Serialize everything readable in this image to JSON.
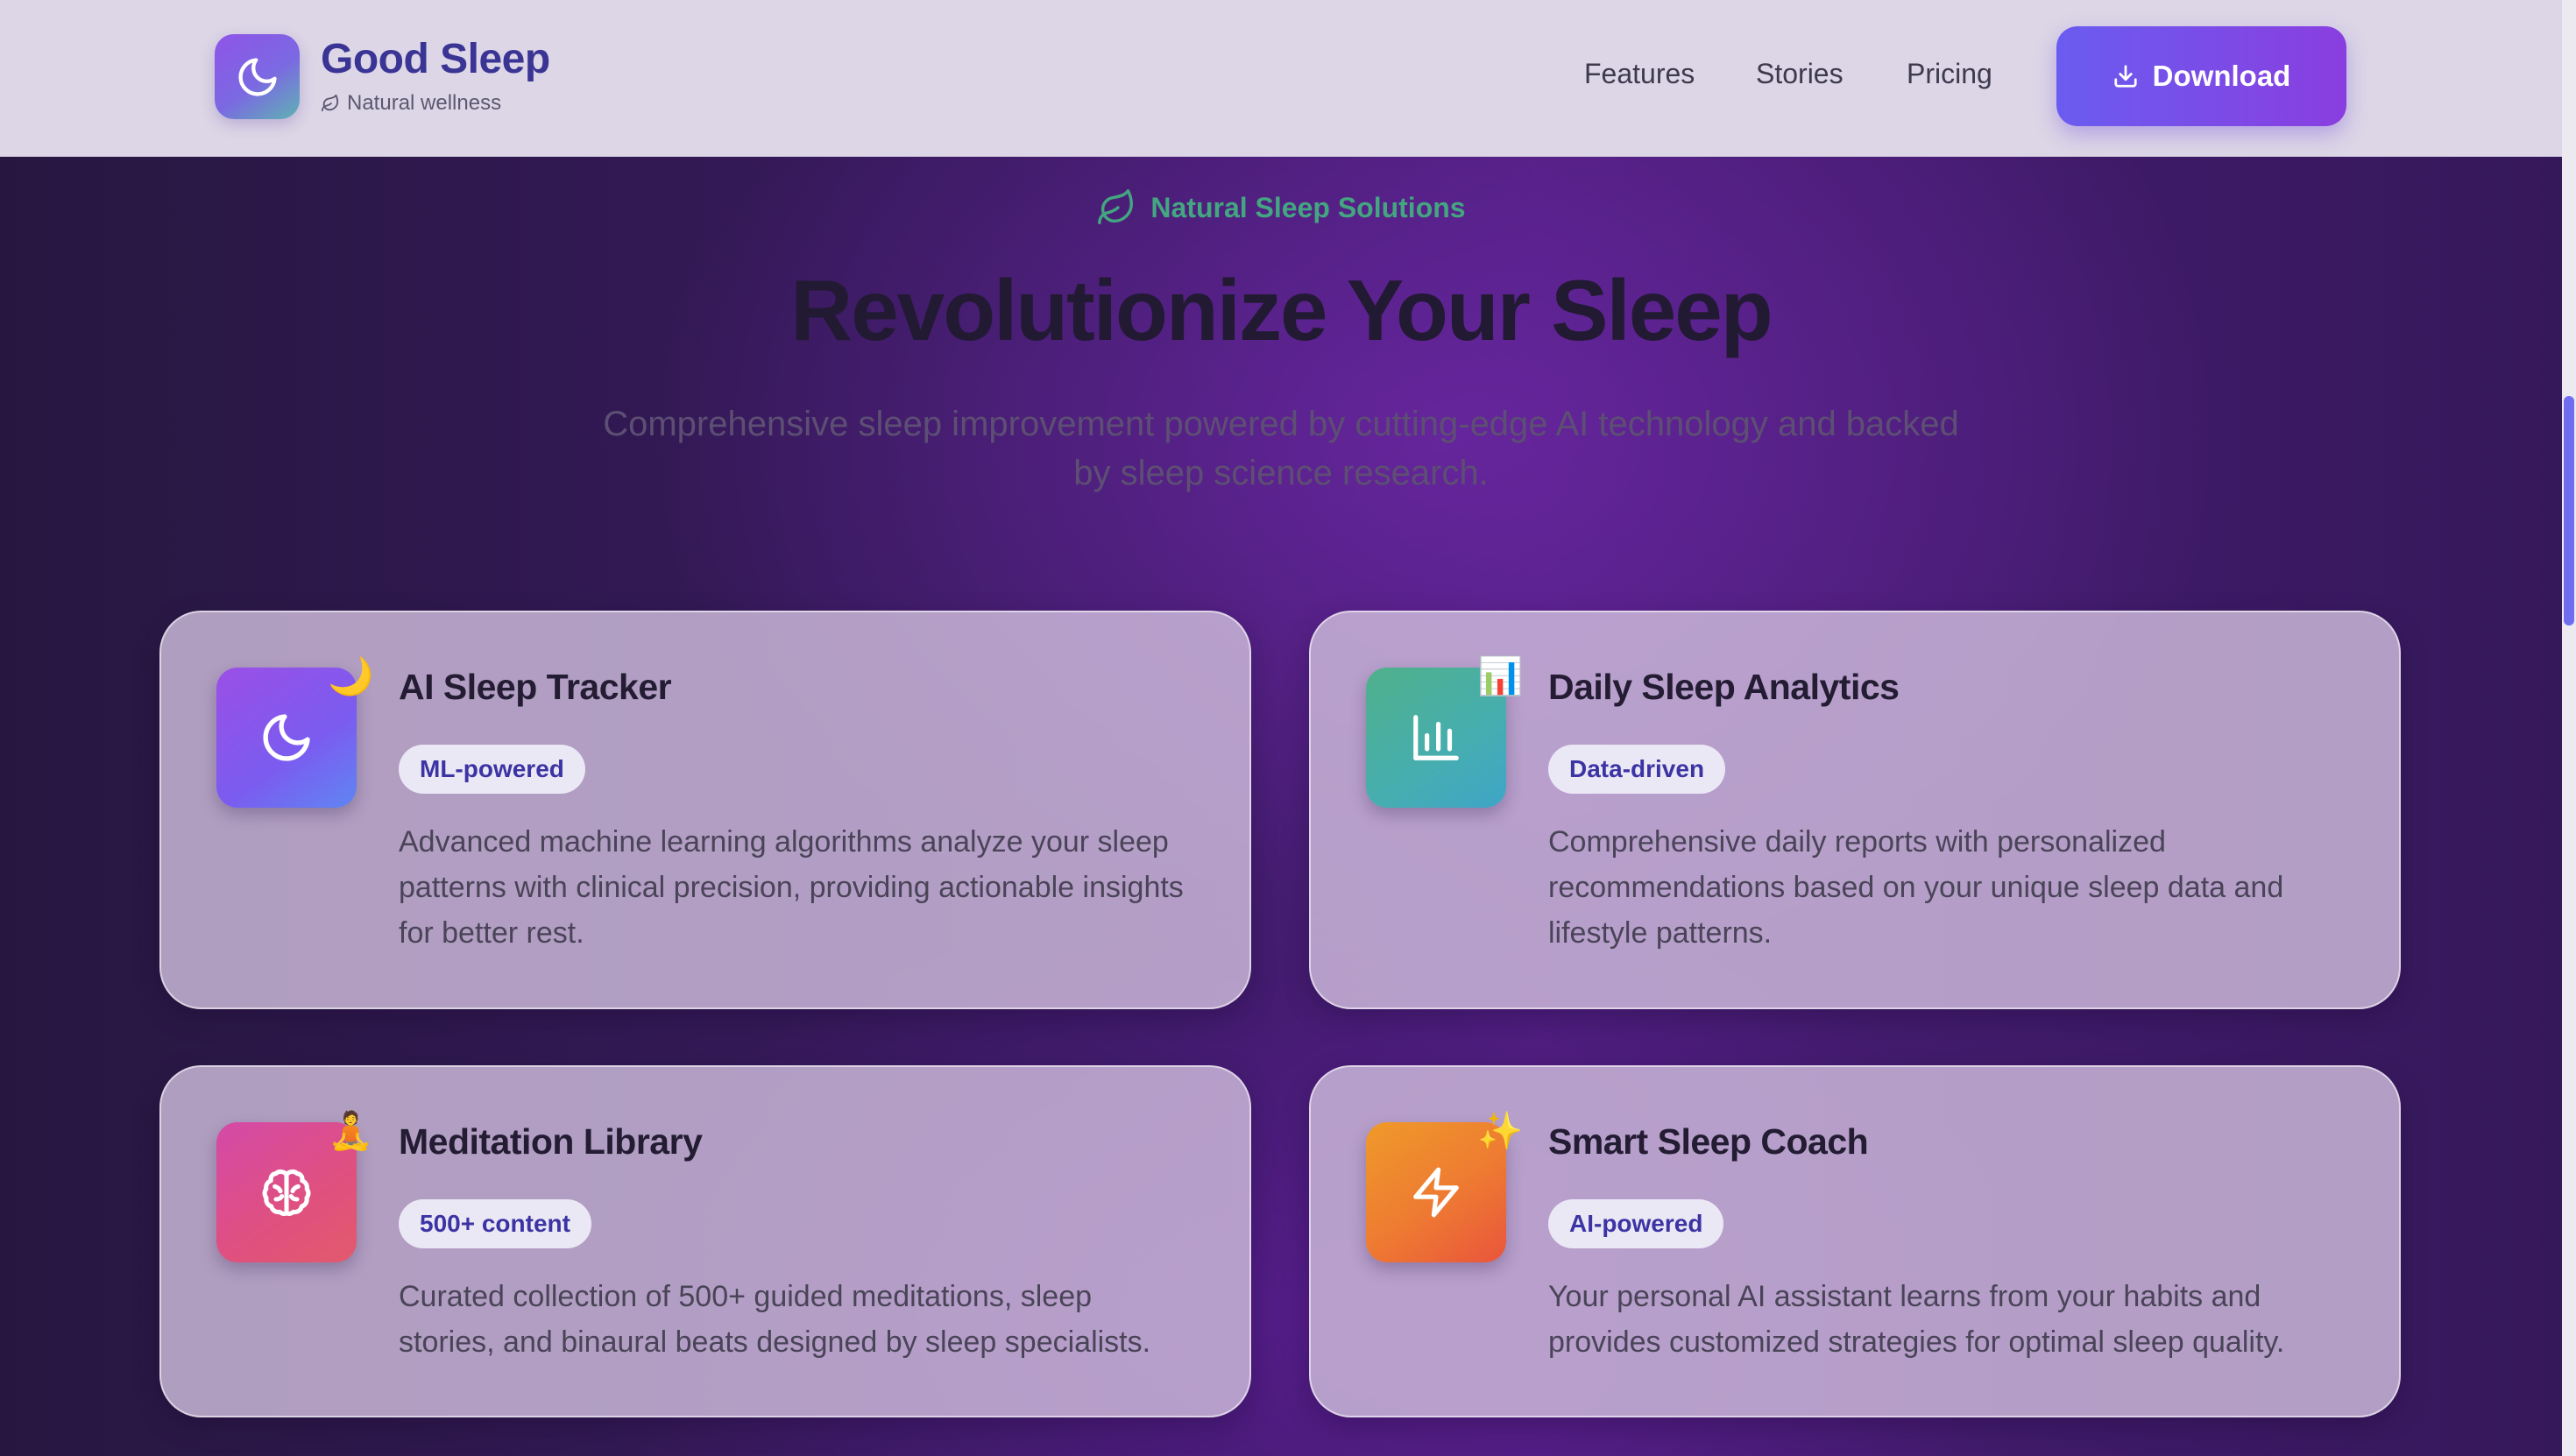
{
  "header": {
    "brand_name": "Good Sleep",
    "brand_sub": "Natural wellness",
    "nav": [
      "Features",
      "Stories",
      "Pricing"
    ],
    "download_label": "Download"
  },
  "hero": {
    "tag": "Natural Sleep Solutions",
    "title": "Revolutionize Your Sleep",
    "subtitle": "Comprehensive sleep improvement powered by cutting-edge AI technology and backed by sleep science research."
  },
  "cards": [
    {
      "icon": "moon-icon",
      "emoji": "🌙",
      "title": "AI Sleep Tracker",
      "badge": "ML-powered",
      "description": "Advanced machine learning algorithms analyze your sleep patterns with clinical precision, providing actionable insights for better rest."
    },
    {
      "icon": "bar-chart-icon",
      "emoji": "📊",
      "title": "Daily Sleep Analytics",
      "badge": "Data-driven",
      "description": "Comprehensive daily reports with personalized recommendations based on your unique sleep data and lifestyle patterns."
    },
    {
      "icon": "brain-icon",
      "emoji": "🧘",
      "title": "Meditation Library",
      "badge": "500+ content",
      "description": "Curated collection of 500+ guided meditations, sleep stories, and binaural beats designed by sleep specialists."
    },
    {
      "icon": "lightning-icon",
      "emoji": "✨",
      "title": "Smart Sleep Coach",
      "badge": "AI-powered",
      "description": "Your personal AI assistant learns from your habits and provides customized strategies for optimal sleep quality."
    }
  ],
  "colors": {
    "brand_text": "#3a3494",
    "accent_green": "#43a680",
    "button_gradient_start": "#6a5cf0",
    "button_gradient_end": "#8a3ee0",
    "background": "#3a1a62"
  }
}
